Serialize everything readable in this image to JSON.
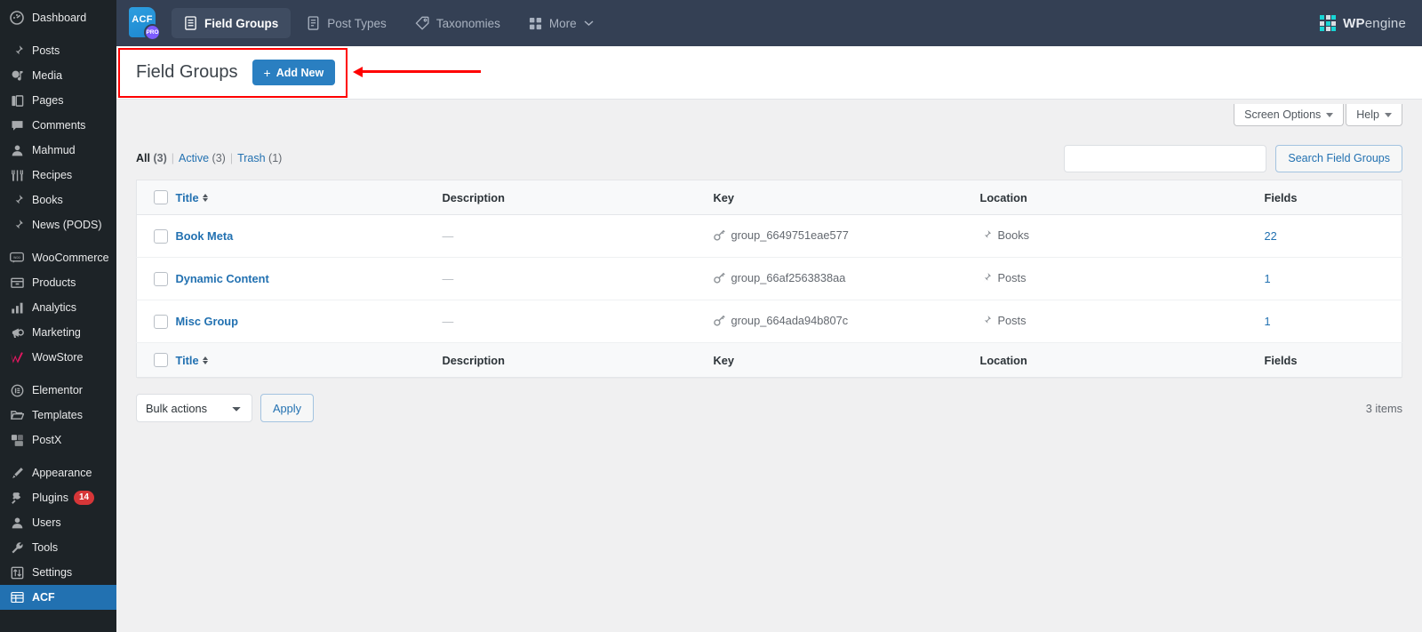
{
  "sidebar": {
    "items": [
      {
        "label": "Dashboard",
        "icon": "dashboard-icon",
        "group": 0
      },
      {
        "label": "Posts",
        "icon": "pin-icon",
        "group": 1
      },
      {
        "label": "Media",
        "icon": "media-icon",
        "group": 1
      },
      {
        "label": "Pages",
        "icon": "pages-icon",
        "group": 1
      },
      {
        "label": "Comments",
        "icon": "comment-icon",
        "group": 1
      },
      {
        "label": "Mahmud",
        "icon": "user-icon",
        "group": 1
      },
      {
        "label": "Recipes",
        "icon": "utensils-icon",
        "group": 1
      },
      {
        "label": "Books",
        "icon": "pin-icon",
        "group": 1
      },
      {
        "label": "News (PODS)",
        "icon": "pin-icon",
        "group": 1
      },
      {
        "label": "WooCommerce",
        "icon": "woo-icon",
        "group": 2
      },
      {
        "label": "Products",
        "icon": "products-icon",
        "group": 2
      },
      {
        "label": "Analytics",
        "icon": "analytics-icon",
        "group": 2
      },
      {
        "label": "Marketing",
        "icon": "megaphone-icon",
        "group": 2
      },
      {
        "label": "WowStore",
        "icon": "wowstore-icon",
        "group": 2
      },
      {
        "label": "Elementor",
        "icon": "elementor-icon",
        "group": 3
      },
      {
        "label": "Templates",
        "icon": "folder-icon",
        "group": 3
      },
      {
        "label": "PostX",
        "icon": "postx-icon",
        "group": 3
      },
      {
        "label": "Appearance",
        "icon": "brush-icon",
        "group": 4
      },
      {
        "label": "Plugins",
        "icon": "plug-icon",
        "group": 4,
        "badge": "14"
      },
      {
        "label": "Users",
        "icon": "user-icon",
        "group": 4
      },
      {
        "label": "Tools",
        "icon": "wrench-icon",
        "group": 4
      },
      {
        "label": "Settings",
        "icon": "settings-icon",
        "group": 4
      },
      {
        "label": "ACF",
        "icon": "acf-grid-icon",
        "group": 4,
        "active": true
      }
    ]
  },
  "acf_bar": {
    "logo_text": "ACF",
    "logo_badge": "PRO",
    "tabs": [
      {
        "label": "Field Groups",
        "icon": "list-doc-icon",
        "active": true
      },
      {
        "label": "Post Types",
        "icon": "doc-icon",
        "active": false
      },
      {
        "label": "Taxonomies",
        "icon": "tag-icon",
        "active": false
      },
      {
        "label": "More",
        "icon": "grid-icon",
        "active": false,
        "caret": true
      }
    ],
    "brand": {
      "bold": "WP",
      "light": "engine",
      "grid_icon": "wpengine-grid-icon"
    }
  },
  "header": {
    "page_title": "Field Groups",
    "add_new_label": "Add New",
    "add_new_plus": "+"
  },
  "screen_meta": {
    "screen_options_label": "Screen Options",
    "help_label": "Help"
  },
  "filters": {
    "links": [
      {
        "label": "All",
        "count": "(3)",
        "current": true
      },
      {
        "label": "Active",
        "count": "(3)",
        "current": false
      },
      {
        "label": "Trash",
        "count": "(1)",
        "current": false
      }
    ],
    "separator": "|"
  },
  "search": {
    "value": "",
    "placeholder": "",
    "button_label": "Search Field Groups"
  },
  "table": {
    "columns": {
      "title": "Title",
      "description": "Description",
      "key": "Key",
      "location": "Location",
      "fields": "Fields"
    },
    "rows": [
      {
        "title": "Book Meta",
        "description": "—",
        "key": "group_6649751eae577",
        "key_icon": "key-icon",
        "location": "Books",
        "location_icon": "pin-icon",
        "fields": "22"
      },
      {
        "title": "Dynamic Content",
        "description": "—",
        "key": "group_66af2563838aa",
        "key_icon": "key-icon",
        "location": "Posts",
        "location_icon": "pin-icon",
        "fields": "1"
      },
      {
        "title": "Misc Group",
        "description": "—",
        "key": "group_664ada94b807c",
        "key_icon": "key-icon",
        "location": "Posts",
        "location_icon": "pin-icon",
        "fields": "1"
      }
    ]
  },
  "tablenav": {
    "bulk_actions_selected": "Bulk actions",
    "bulk_actions_options": [
      "Bulk actions"
    ],
    "apply_label": "Apply",
    "items_count": "3 items"
  },
  "colors": {
    "wp_admin_bg": "#1d2327",
    "acf_bar_bg": "#344054",
    "accent_blue": "#2271b1",
    "add_new_blue": "#2a7fc1",
    "annotation_red": "#ff0000",
    "badge_red": "#d63638",
    "wpengine_teal": "#18d6d6"
  }
}
